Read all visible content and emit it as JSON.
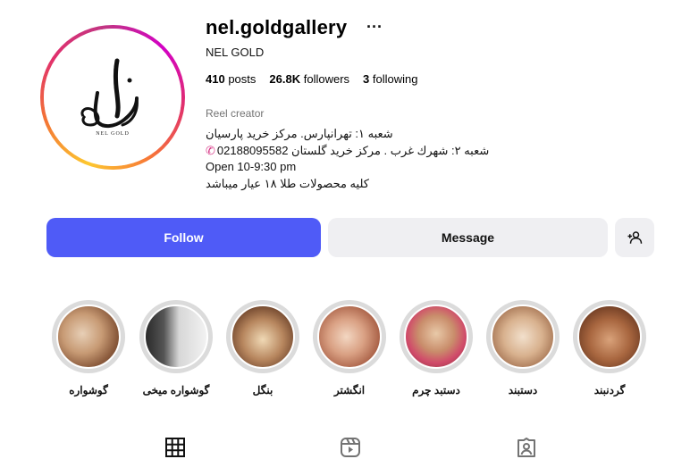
{
  "profile": {
    "username": "nel.goldgallery",
    "more_icon": "more-dots-icon",
    "full_name": "NEL GOLD",
    "logo_caption": "NEL GOLD",
    "stats": {
      "posts_count": "410",
      "posts_label": "posts",
      "followers_count": "26.8K",
      "followers_label": "followers",
      "following_count": "3",
      "following_label": "following"
    },
    "category": "Reel creator",
    "bio": {
      "line1": "شعبه ۱: تهرانپارس. مرکز خرید پارسیان",
      "line2": "شعبه ۲: شهرك غرب . مرکز خرید گلستان 02188095582",
      "line3": "Open 10-9:30 pm",
      "line4": "کلیه محصولات طلا ۱۸ عیار میباشد"
    }
  },
  "actions": {
    "follow": "Follow",
    "message": "Message",
    "add_user_icon": "add-user-icon"
  },
  "highlights": [
    {
      "label": "گوشواره"
    },
    {
      "label": "گوشواره میخی"
    },
    {
      "label": "بنگل"
    },
    {
      "label": "انگشتر"
    },
    {
      "label": "دستبد چرم"
    },
    {
      "label": "دستبند"
    },
    {
      "label": "گردنبند"
    }
  ],
  "tabs": [
    "grid-icon",
    "reels-icon",
    "tagged-icon"
  ],
  "colors": {
    "follow_button": "#4f5bf7",
    "secondary_button": "#efeff2",
    "muted_text": "#737373",
    "phone_icon": "#d63384"
  }
}
